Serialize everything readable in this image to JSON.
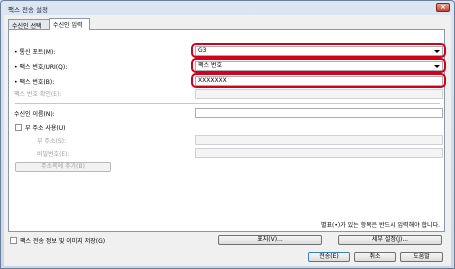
{
  "window": {
    "title": "팩스 전송 설정",
    "close_symbol": "×"
  },
  "tabs": [
    {
      "label": "수신인 선택",
      "active": false
    },
    {
      "label": "수신인 입력",
      "active": true
    }
  ],
  "form": {
    "port": {
      "label": "• 통신 포트(M):",
      "value": "G3"
    },
    "fax_number_type": {
      "label": "• 팩스 번호/URI(Q):",
      "value": "팩스 번호"
    },
    "fax_number": {
      "label": "• 팩스 번호(B):",
      "value": "XXXXXXX"
    },
    "fax_number_confirm": {
      "label": "팩스 번호 확인(E):",
      "value": ""
    },
    "recipient_name": {
      "label": "수신인 이름(N):",
      "value": ""
    },
    "use_sub_address": {
      "label": "부 주소 사용(U)",
      "checked": false
    },
    "sub_address": {
      "label": "부 주소(S):",
      "value": ""
    },
    "password": {
      "label": "비밀번호(E):",
      "value": ""
    },
    "add_to_address_book": {
      "label": "주소록에 추가(B)"
    }
  },
  "required_note": "별표(•)가 있는 항목은 반드시 입력해야 합니다.",
  "footer": {
    "save_fax_info": {
      "label": "팩스 전송 정보 및 이미지 저장(G)",
      "checked": false
    },
    "cover_sheet_button": "표지(V)...",
    "details_button": "세부 설정(J)...",
    "send_button": "전송(E)",
    "cancel_button": "취소",
    "help_button": "도움말"
  },
  "colors": {
    "highlight": "#d0021b"
  }
}
